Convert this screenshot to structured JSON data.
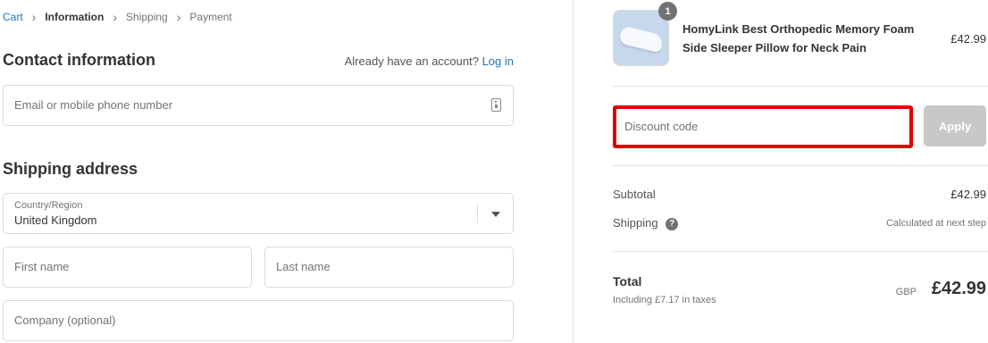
{
  "breadcrumb": {
    "items": [
      "Cart",
      "Information",
      "Shipping",
      "Payment"
    ],
    "separator": ">"
  },
  "contact": {
    "title": "Contact information",
    "account_prompt": "Already have an account?",
    "login_label": "Log in",
    "email_placeholder": "Email or mobile phone number",
    "email_icon": "contact-card-icon"
  },
  "shipping": {
    "title": "Shipping address",
    "country_label": "Country/Region",
    "country_value": "United Kingdom",
    "first_name_placeholder": "First name",
    "last_name_placeholder": "Last name",
    "company_placeholder": "Company (optional)"
  },
  "order": {
    "product_name": "HomyLink Best Orthopedic Memory Foam Side Sleeper Pillow for Neck Pain",
    "product_price": "£42.99",
    "quantity": "1",
    "discount_placeholder": "Discount code",
    "apply_label": "Apply",
    "subtotal_label": "Subtotal",
    "subtotal_value": "£42.99",
    "shipping_label": "Shipping",
    "shipping_value": "Calculated at next step",
    "help_icon": "question-circle-icon",
    "total_label": "Total",
    "tax_note": "Including £7.17 in taxes",
    "currency": "GBP",
    "total_value": "£42.99"
  },
  "colors": {
    "link": "#1f73b7",
    "highlight": "#e10000",
    "button_disabled": "#c8c8c8"
  }
}
